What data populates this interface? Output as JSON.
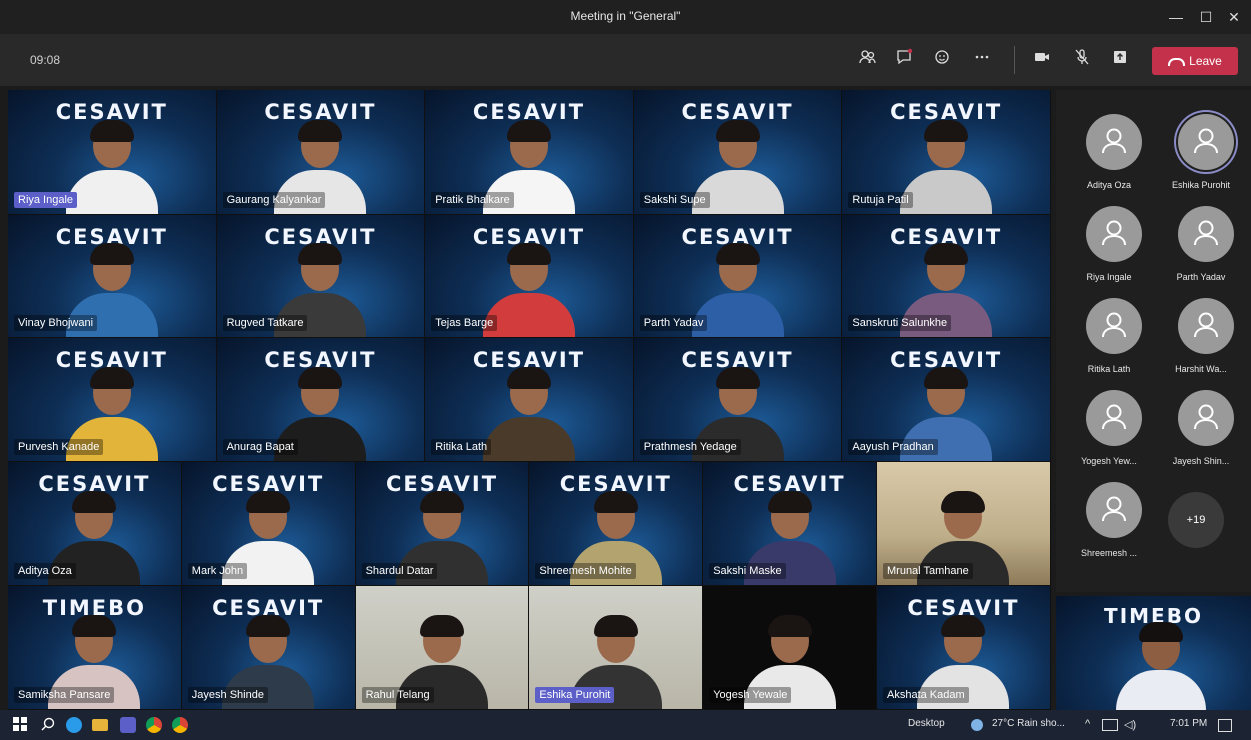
{
  "window": {
    "title": "Meeting in \"General\"",
    "minimize": "—",
    "maximize": "☐",
    "close": "✕"
  },
  "toolbar": {
    "clock": "09:08",
    "icons": [
      "participants-icon",
      "chat-icon",
      "reactions-icon",
      "more-icon",
      "camera-icon",
      "mic-off-icon",
      "share-icon"
    ],
    "leave_label": "Leave",
    "leave_color": "#c4314b"
  },
  "brand_text": "CESAVIT",
  "brand_alt": "TIMEBO",
  "tiles": [
    {
      "name": "Riya Ingale"
    },
    {
      "name": "Gaurang Kalyankar"
    },
    {
      "name": "Pratik Bhalkare"
    },
    {
      "name": "Sakshi Supe"
    },
    {
      "name": "Rutuja Patil"
    },
    {
      "name": "Vinay Bhojwani"
    },
    {
      "name": "Rugved Tatkare"
    },
    {
      "name": "Tejas Barge"
    },
    {
      "name": "Parth Yadav"
    },
    {
      "name": "Sanskruti Salunkhe"
    },
    {
      "name": "Purvesh Kanade"
    },
    {
      "name": "Anurag Bapat"
    },
    {
      "name": "Ritika Lath"
    },
    {
      "name": "Prathmesh Yedage"
    },
    {
      "name": "Aayush Pradhan"
    },
    {
      "name": "Aditya Oza"
    },
    {
      "name": "Mark John"
    },
    {
      "name": "Shardul Datar"
    },
    {
      "name": "Shreemesh Mohite"
    },
    {
      "name": "Sakshi Maske"
    },
    {
      "name": "Mrunal Tamhane"
    },
    {
      "name": "Samiksha Pansare"
    },
    {
      "name": "Jayesh Shinde"
    },
    {
      "name": "Rahul Telang"
    },
    {
      "name": "Eshika Purohit"
    },
    {
      "name": "Yogesh Yewale"
    },
    {
      "name": "Akshata Kadam"
    }
  ],
  "panel": {
    "participants": [
      "Aditya Oza",
      "Eshika Purohit",
      "Riya Ingale",
      "Parth Yadav",
      "Ritika Lath",
      "Harshit Wa...",
      "Yogesh Yew...",
      "Jayesh Shin...",
      "Shreemesh ..."
    ],
    "more_label": "+19"
  },
  "taskbar": {
    "desktop": "Desktop",
    "weather": "27°C  Rain sho...",
    "time": "7:01 PM"
  }
}
